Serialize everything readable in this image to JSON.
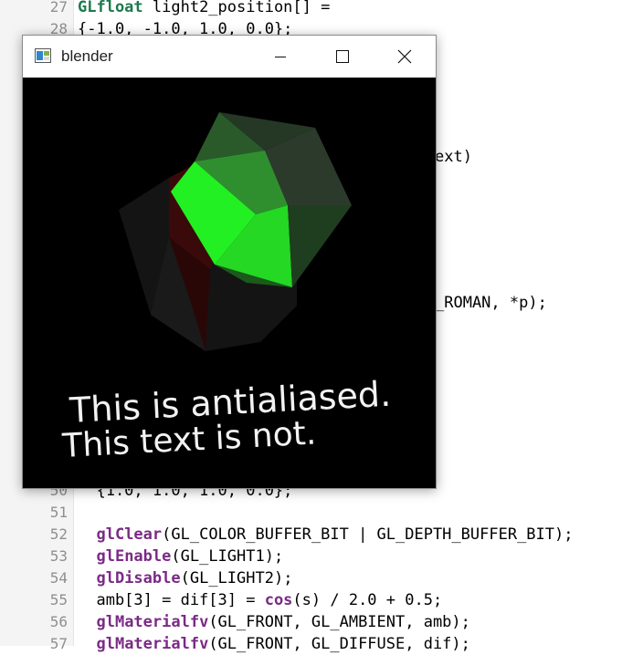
{
  "editor": {
    "lines_top": [
      {
        "num": "27",
        "parts": [
          {
            "t": "GLfloat",
            "c": "kw-green"
          },
          {
            "t": " light2_position[] =",
            "c": ""
          }
        ]
      },
      {
        "num": "28",
        "parts": [
          {
            "t": "{-1.0, -1.0, 1.0, 0.0};",
            "c": ""
          }
        ]
      }
    ],
    "occluded_fragments": {
      "ctx_tail": "ext)",
      "roman_tail": "_ROMAN, *p);"
    },
    "lines_bottom": [
      {
        "num": "50",
        "parts": [
          {
            "t": "  {1.0, 1.0, 1.0, 0.0};",
            "c": ""
          }
        ]
      },
      {
        "num": "51",
        "parts": [
          {
            "t": "",
            "c": ""
          }
        ]
      },
      {
        "num": "52",
        "parts": [
          {
            "t": "  ",
            "c": ""
          },
          {
            "t": "glClear",
            "c": "kw-fn"
          },
          {
            "t": "(GL_COLOR_BUFFER_BIT | GL_DEPTH_BUFFER_BIT);",
            "c": ""
          }
        ]
      },
      {
        "num": "53",
        "parts": [
          {
            "t": "  ",
            "c": ""
          },
          {
            "t": "glEnable",
            "c": "kw-fn"
          },
          {
            "t": "(GL_LIGHT1);",
            "c": ""
          }
        ]
      },
      {
        "num": "54",
        "parts": [
          {
            "t": "  ",
            "c": ""
          },
          {
            "t": "glDisable",
            "c": "kw-fn"
          },
          {
            "t": "(GL_LIGHT2);",
            "c": ""
          }
        ]
      },
      {
        "num": "55",
        "parts": [
          {
            "t": "  amb[3] = dif[3] = ",
            "c": ""
          },
          {
            "t": "cos",
            "c": "kw-fn"
          },
          {
            "t": "(s) / 2.0 + 0.5;",
            "c": ""
          }
        ]
      },
      {
        "num": "56",
        "parts": [
          {
            "t": "  ",
            "c": ""
          },
          {
            "t": "glMaterialfv",
            "c": "kw-fn"
          },
          {
            "t": "(GL_FRONT, GL_AMBIENT, amb);",
            "c": ""
          }
        ]
      },
      {
        "num": "57",
        "parts": [
          {
            "t": "  ",
            "c": ""
          },
          {
            "t": "glMaterialfv",
            "c": "kw-fn"
          },
          {
            "t": "(GL_FRONT, GL_DIFFUSE, dif);",
            "c": ""
          }
        ]
      }
    ]
  },
  "window": {
    "title": "blender",
    "minimize_glyph": "—",
    "maximize_glyph": "☐",
    "close_glyph": "✕",
    "icons": {
      "app": "blender-app-icon",
      "minimize": "minimize-icon",
      "maximize": "maximize-icon",
      "close": "close-icon"
    }
  },
  "canvas": {
    "text_line_1": "This is antialiased.",
    "text_line_2": "This text is not.",
    "colors": {
      "bright_green": "#22ee22",
      "mid_green": "#2a8a2a",
      "dark_green": "#1d4a1d",
      "dark_red": "#3a0a0a",
      "gray": "#161616"
    }
  }
}
